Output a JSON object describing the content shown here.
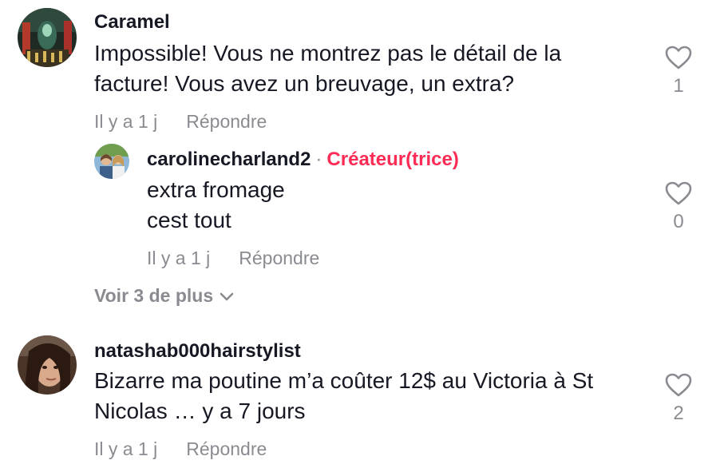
{
  "comments": [
    {
      "username": "Caramel",
      "text_lines": [
        "Impossible! Vous ne montrez pas le détail de la",
        "facture! Vous avez un breuvage, un extra?"
      ],
      "time": "Il y a 1 j",
      "reply_label": "Répondre",
      "likes": "1",
      "replies": [
        {
          "username": "carolinecharland2",
          "separator": "·",
          "badge": "Créateur(trice)",
          "text_lines": [
            "extra fromage",
            "cest tout"
          ],
          "time": "Il y a 1 j",
          "reply_label": "Répondre",
          "likes": "0"
        }
      ],
      "view_more": "Voir 3 de plus"
    },
    {
      "username": "natashab000hairstylist",
      "text_lines": [
        "Bizarre ma poutine m’a coûter 12$ au Victoria à St",
        "Nicolas … y a 7 jours"
      ],
      "time": "Il y a 1 j",
      "reply_label": "Répondre",
      "likes": "2"
    }
  ],
  "colors": {
    "text": "#161823",
    "muted": "#8a8b91",
    "creator_badge": "#fe2c55"
  }
}
